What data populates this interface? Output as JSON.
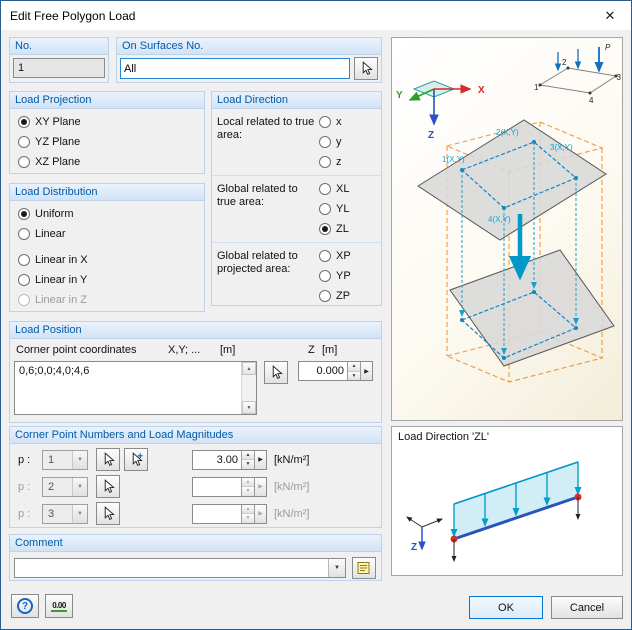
{
  "window": {
    "title": "Edit Free Polygon Load"
  },
  "icons": {
    "close": "✕",
    "dropdown": "▼",
    "spin_up": "▲",
    "spin_down": "▼",
    "side_arrow": "▶",
    "help": "?",
    "decimals": "0.00"
  },
  "no_group": {
    "title": "No.",
    "value": "1"
  },
  "surfaces_group": {
    "title": "On Surfaces No.",
    "value": "All"
  },
  "projection_group": {
    "title": "Load Projection",
    "options": [
      {
        "label": "XY Plane",
        "selected": true
      },
      {
        "label": "YZ Plane",
        "selected": false
      },
      {
        "label": "XZ Plane",
        "selected": false
      }
    ]
  },
  "direction_group": {
    "title": "Load Direction",
    "sections": [
      {
        "label": "Local related to true area:",
        "options": [
          {
            "label": "x",
            "selected": false
          },
          {
            "label": "y",
            "selected": false
          },
          {
            "label": "z",
            "selected": false
          }
        ]
      },
      {
        "label": "Global related to true area:",
        "options": [
          {
            "label": "XL",
            "selected": false
          },
          {
            "label": "YL",
            "selected": false
          },
          {
            "label": "ZL",
            "selected": true
          }
        ]
      },
      {
        "label": "Global related to projected area:",
        "options": [
          {
            "label": "XP",
            "selected": false
          },
          {
            "label": "YP",
            "selected": false
          },
          {
            "label": "ZP",
            "selected": false
          }
        ]
      }
    ]
  },
  "distribution_group": {
    "title": "Load Distribution",
    "options": [
      {
        "label": "Uniform",
        "selected": true,
        "enabled": true
      },
      {
        "label": "Linear",
        "selected": false,
        "enabled": true
      },
      {
        "label": "Linear in X",
        "selected": false,
        "enabled": true
      },
      {
        "label": "Linear in Y",
        "selected": false,
        "enabled": true
      },
      {
        "label": "Linear in Z",
        "selected": false,
        "enabled": false
      }
    ]
  },
  "position_group": {
    "title": "Load Position",
    "coords_label": "Corner point coordinates",
    "coords_format": "X,Y; ...",
    "coords_unit": "[m]",
    "coords_value": "0,6;0,0;4,0;4,6",
    "z_label": "Z",
    "z_unit": "[m]",
    "z_value": "0.000"
  },
  "magnitudes_group": {
    "title": "Corner Point Numbers and Load Magnitudes",
    "rows": [
      {
        "label": "p :",
        "point": "1",
        "value": "3.00",
        "unit": "[kN/m²]",
        "enabled": true
      },
      {
        "label": "p :",
        "point": "2",
        "value": "",
        "unit": "[kN/m²]",
        "enabled": false
      },
      {
        "label": "p :",
        "point": "3",
        "value": "",
        "unit": "[kN/m²]",
        "enabled": false
      }
    ]
  },
  "comment_group": {
    "title": "Comment",
    "value": ""
  },
  "preview": {
    "triad": {
      "x": "X",
      "y": "Y",
      "z": "Z"
    },
    "mini": {
      "p": "P",
      "n1": "1",
      "n2": "2",
      "n3": "3",
      "n4": "4"
    },
    "corners": {
      "c1": "1(X,Y)",
      "c2": "2(X,Y)",
      "c3": "3(X,Y)",
      "c4": "4(X,Y)"
    },
    "zl_title": "Load Direction 'ZL'",
    "zl_axis": "Z"
  },
  "footer": {
    "ok": "OK",
    "cancel": "Cancel"
  },
  "colors": {
    "accent": "#005aa9",
    "group_header_bg": "#d8e6f7",
    "axis_x": "#d42a2a",
    "axis_y": "#2ca02c",
    "axis_z": "#2b50c8",
    "load_teal": "#0098c8",
    "box_orange": "#f09a3c",
    "corner_label_cyan": "#00aadc",
    "ok_border": "#0078d7"
  }
}
